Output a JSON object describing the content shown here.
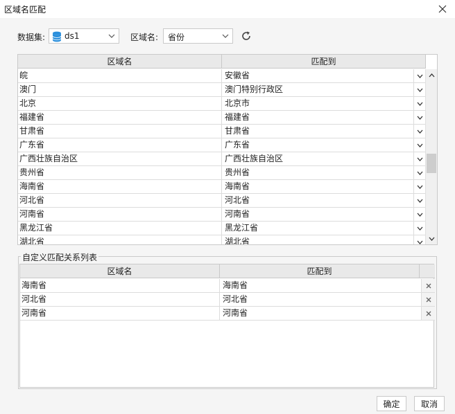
{
  "window": {
    "title": "区域名匹配"
  },
  "controls": {
    "dataset_label": "数据集:",
    "dataset_value": "ds1",
    "region_label": "区域名:",
    "region_value": "省份"
  },
  "main_table": {
    "headers": [
      "区域名",
      "匹配到"
    ],
    "rows": [
      {
        "name": "皖",
        "match": "安徽省"
      },
      {
        "name": "澳门",
        "match": "澳门特别行政区"
      },
      {
        "name": "北京",
        "match": "北京市"
      },
      {
        "name": "福建省",
        "match": "福建省"
      },
      {
        "name": "甘肃省",
        "match": "甘肃省"
      },
      {
        "name": "广东省",
        "match": "广东省"
      },
      {
        "name": "广西壮族自治区",
        "match": "广西壮族自治区"
      },
      {
        "name": "贵州省",
        "match": "贵州省"
      },
      {
        "name": "海南省",
        "match": "海南省"
      },
      {
        "name": "河北省",
        "match": "河北省"
      },
      {
        "name": "河南省",
        "match": "河南省"
      },
      {
        "name": "黑龙江省",
        "match": "黑龙江省"
      },
      {
        "name": "湖北省",
        "match": "湖北省"
      }
    ],
    "scroll_position": 0.55
  },
  "custom_table": {
    "group_title": "自定义匹配关系列表",
    "headers": [
      "区域名",
      "匹配到"
    ],
    "rows": [
      {
        "name": "海南省",
        "match": "海南省"
      },
      {
        "name": "河北省",
        "match": "河北省"
      },
      {
        "name": "河南省",
        "match": "河南省"
      }
    ]
  },
  "buttons": {
    "ok": "确定",
    "cancel": "取消"
  },
  "icons": {
    "close": "close-icon",
    "database": "database-icon",
    "dropdown": "chevron-down-icon",
    "refresh": "refresh-icon",
    "delete": "delete-x-icon",
    "scroll_up": "chevron-up-icon",
    "scroll_down": "chevron-down-icon"
  },
  "colors": {
    "database_icon": "#2a8fdc",
    "header_bg": "#e9e9e9",
    "dialog_bg": "#f5f5f5"
  }
}
